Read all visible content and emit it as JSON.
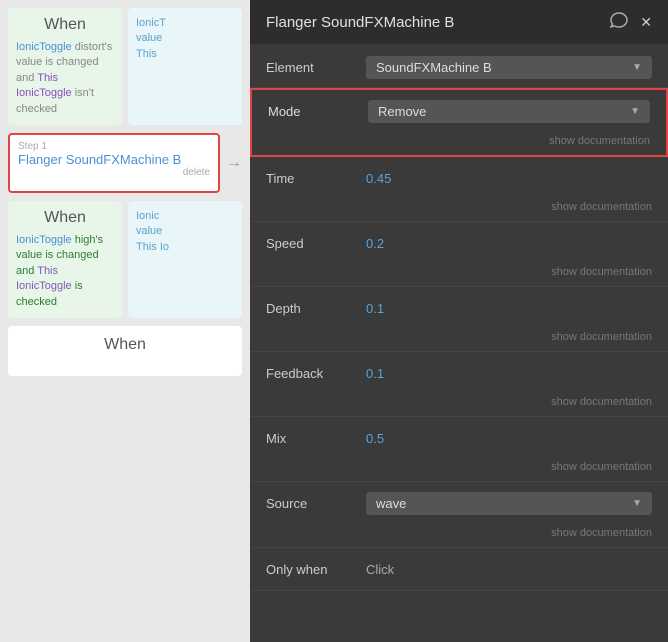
{
  "leftPanel": {
    "card1": {
      "title": "When",
      "leftText": "IonicToggle distort's value is changed and This IonicToggle isn't checked",
      "rightTextVisible": "IonicT value This"
    },
    "stepCard": {
      "stepLabel": "Step 1",
      "stepTitle": "Flanger SoundFXMachine B",
      "deleteLabel": "delete"
    },
    "card2": {
      "title": "When",
      "leftText": "IonicToggle high's value is changed and This IonicToggle is checked",
      "rightText": "Ionic value This Io"
    },
    "card3": {
      "title": "When"
    }
  },
  "rightPanel": {
    "title": "Flanger SoundFXMachine B",
    "commentIcon": "💬",
    "closeIcon": "✕",
    "fields": [
      {
        "label": "Element",
        "type": "select",
        "value": "SoundFXMachine B",
        "showDoc": false
      },
      {
        "label": "Mode",
        "type": "select",
        "value": "Remove",
        "highlighted": true,
        "showDoc": true,
        "docLabel": "show documentation"
      },
      {
        "label": "Time",
        "type": "value",
        "value": "0.45",
        "showDoc": true,
        "docLabel": "show documentation"
      },
      {
        "label": "Speed",
        "type": "value",
        "value": "0.2",
        "showDoc": true,
        "docLabel": "show documentation"
      },
      {
        "label": "Depth",
        "type": "value",
        "value": "0.1",
        "showDoc": true,
        "docLabel": "show documentation"
      },
      {
        "label": "Feedback",
        "type": "value",
        "value": "0.1",
        "showDoc": true,
        "docLabel": "show documentation"
      },
      {
        "label": "Mix",
        "type": "value",
        "value": "0.5",
        "showDoc": true,
        "docLabel": "show documentation"
      },
      {
        "label": "Source",
        "type": "select",
        "value": "wave",
        "showDoc": true,
        "docLabel": "show documentation"
      },
      {
        "label": "Only when",
        "type": "value",
        "value": "Click",
        "valueColor": "#aaa",
        "showDoc": false
      }
    ]
  }
}
